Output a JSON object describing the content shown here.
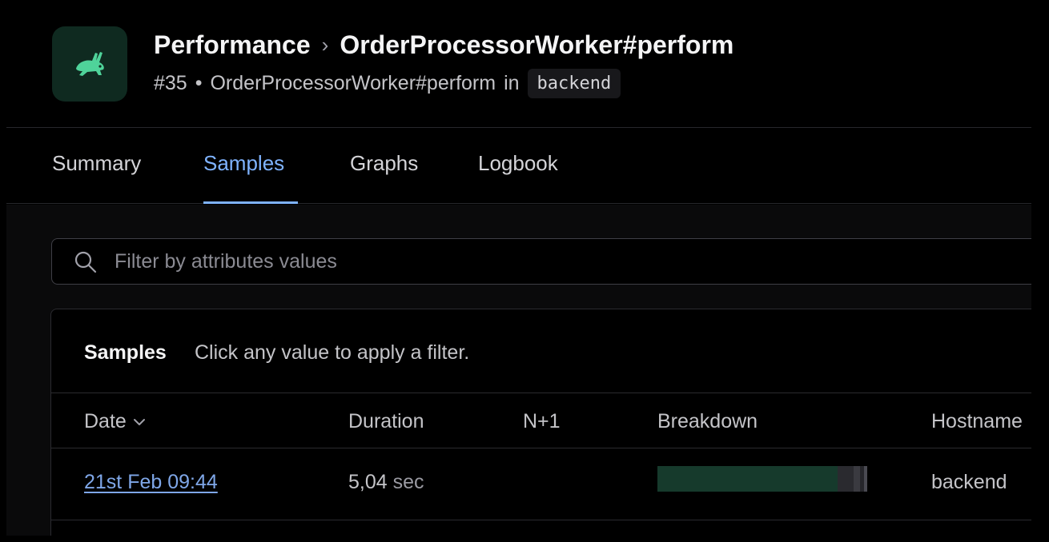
{
  "header": {
    "breadcrumb_root": "Performance",
    "breadcrumb_separator": "›",
    "title": "OrderProcessorWorker#perform",
    "incident_number": "#35",
    "bullet": "•",
    "subtitle_action": "OrderProcessorWorker#perform",
    "subtitle_in": "in",
    "namespace_badge": "backend",
    "logo_icon": "rabbit-icon"
  },
  "tabs": [
    {
      "label": "Summary",
      "active": false
    },
    {
      "label": "Samples",
      "active": true
    },
    {
      "label": "Graphs",
      "active": false
    },
    {
      "label": "Logbook",
      "active": false
    }
  ],
  "search": {
    "placeholder": "Filter by attributes values",
    "value": "",
    "icon": "search-icon"
  },
  "samples_panel": {
    "title": "Samples",
    "hint": "Click any value to apply a filter.",
    "columns": [
      "Date",
      "Duration",
      "N+1",
      "Breakdown",
      "Hostname"
    ],
    "sort_icon": "chevron-down-icon",
    "rows": [
      {
        "date": "21st Feb 09:44",
        "duration_value": "5,04",
        "duration_unit": "sec",
        "n_plus_one": "",
        "hostname": "backend",
        "breakdown": [
          {
            "fraction": 0.86,
            "color": "#163a2c"
          },
          {
            "fraction": 0.075,
            "color": "#2a2a2f"
          },
          {
            "fraction": 0.03,
            "color": "#3a3a40"
          },
          {
            "fraction": 0.02,
            "color": "#26262b"
          },
          {
            "fraction": 0.015,
            "color": "#4a4a52"
          }
        ]
      }
    ]
  },
  "colors": {
    "accent": "#7fb3ff",
    "logo_bg": "#0f2a20",
    "logo_fg": "#4fd39a"
  }
}
